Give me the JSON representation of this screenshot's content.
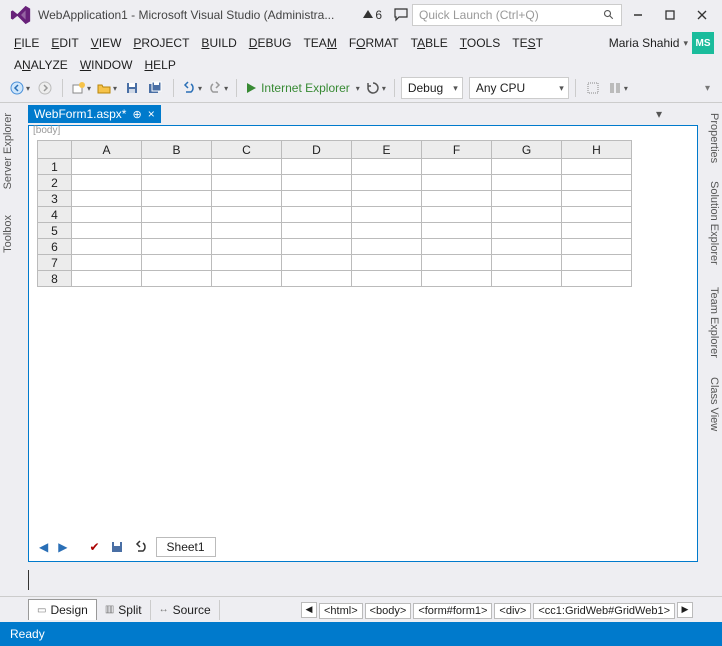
{
  "title": "WebApplication1 - Microsoft Visual Studio (Administra...",
  "notifications": {
    "count": "6"
  },
  "quick_launch": {
    "placeholder": "Quick Launch (Ctrl+Q)"
  },
  "user": {
    "name": "Maria Shahid",
    "initials": "MS"
  },
  "menu_row1": [
    {
      "pre": "",
      "u": "F",
      "post": "ILE"
    },
    {
      "pre": "",
      "u": "E",
      "post": "DIT"
    },
    {
      "pre": "",
      "u": "V",
      "post": "IEW"
    },
    {
      "pre": "",
      "u": "P",
      "post": "ROJECT"
    },
    {
      "pre": "",
      "u": "B",
      "post": "UILD"
    },
    {
      "pre": "",
      "u": "D",
      "post": "EBUG"
    },
    {
      "pre": "TEA",
      "u": "M",
      "post": ""
    },
    {
      "pre": "F",
      "u": "O",
      "post": "RMAT"
    },
    {
      "pre": "T",
      "u": "A",
      "post": "BLE"
    },
    {
      "pre": "",
      "u": "T",
      "post": "OOLS"
    },
    {
      "pre": "TE",
      "u": "S",
      "post": "T"
    }
  ],
  "menu_row2": [
    {
      "pre": "A",
      "u": "N",
      "post": "ALYZE"
    },
    {
      "pre": "",
      "u": "W",
      "post": "INDOW"
    },
    {
      "pre": "",
      "u": "H",
      "post": "ELP"
    }
  ],
  "toolbar": {
    "start_label": "Internet Explorer",
    "config": "Debug",
    "platform": "Any CPU"
  },
  "left_tabs": [
    "Server Explorer",
    "Toolbox"
  ],
  "right_tabs": [
    "Properties",
    "Solution Explorer",
    "Team Explorer",
    "Class View"
  ],
  "doc_tab": {
    "name": "WebForm1.aspx*"
  },
  "body_tag_label": "body",
  "sheet": {
    "columns": [
      "A",
      "B",
      "C",
      "D",
      "E",
      "F",
      "G",
      "H"
    ],
    "rows": [
      "1",
      "2",
      "3",
      "4",
      "5",
      "6",
      "7",
      "8"
    ],
    "tab": "Sheet1"
  },
  "view_tabs": {
    "design": "Design",
    "split": "Split",
    "source": "Source"
  },
  "breadcrumb": [
    "<html>",
    "<body>",
    "<form#form1>",
    "<div>",
    "<cc1:GridWeb#GridWeb1>"
  ],
  "status": "Ready"
}
